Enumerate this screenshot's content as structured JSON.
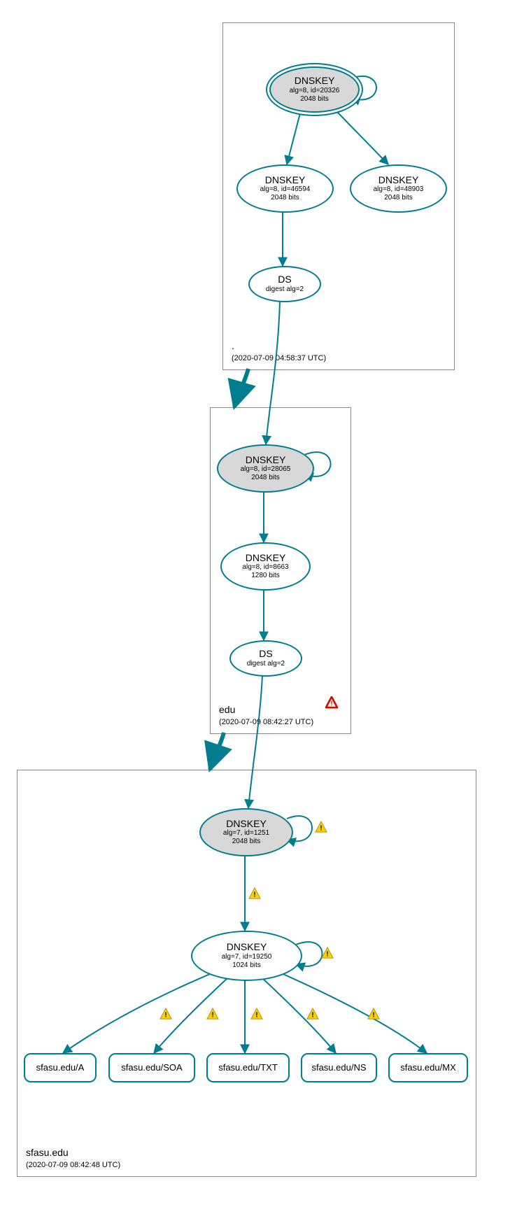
{
  "zones": {
    "root": {
      "label": ".",
      "timestamp": "(2020-07-09 04:58:37 UTC)"
    },
    "edu": {
      "label": "edu",
      "timestamp": "(2020-07-09 08:42:27 UTC)"
    },
    "sfasu": {
      "label": "sfasu.edu",
      "timestamp": "(2020-07-09 08:42:48 UTC)"
    }
  },
  "nodes": {
    "rootKsk": {
      "title": "DNSKEY",
      "sub1": "alg=8, id=20326",
      "sub2": "2048 bits"
    },
    "rootZsk1": {
      "title": "DNSKEY",
      "sub1": "alg=8, id=46594",
      "sub2": "2048 bits"
    },
    "rootZsk2": {
      "title": "DNSKEY",
      "sub1": "alg=8, id=48903",
      "sub2": "2048 bits"
    },
    "rootDs": {
      "title": "DS",
      "sub1": "digest alg=2"
    },
    "eduKsk": {
      "title": "DNSKEY",
      "sub1": "alg=8, id=28065",
      "sub2": "2048 bits"
    },
    "eduZsk": {
      "title": "DNSKEY",
      "sub1": "alg=8, id=8663",
      "sub2": "1280 bits"
    },
    "eduDs": {
      "title": "DS",
      "sub1": "digest alg=2"
    },
    "sfasuKsk": {
      "title": "DNSKEY",
      "sub1": "alg=7, id=1251",
      "sub2": "2048 bits"
    },
    "sfasuZsk": {
      "title": "DNSKEY",
      "sub1": "alg=7, id=19250",
      "sub2": "1024 bits"
    },
    "rrA": {
      "title": "sfasu.edu/A"
    },
    "rrSoa": {
      "title": "sfasu.edu/SOA"
    },
    "rrTxt": {
      "title": "sfasu.edu/TXT"
    },
    "rrNs": {
      "title": "sfasu.edu/NS"
    },
    "rrMx": {
      "title": "sfasu.edu/MX"
    }
  },
  "colors": {
    "edge": "#007d8e",
    "nodeStroke": "#007d8e",
    "warnYellow": "#f0c400",
    "warnRed": "#cc1100"
  }
}
